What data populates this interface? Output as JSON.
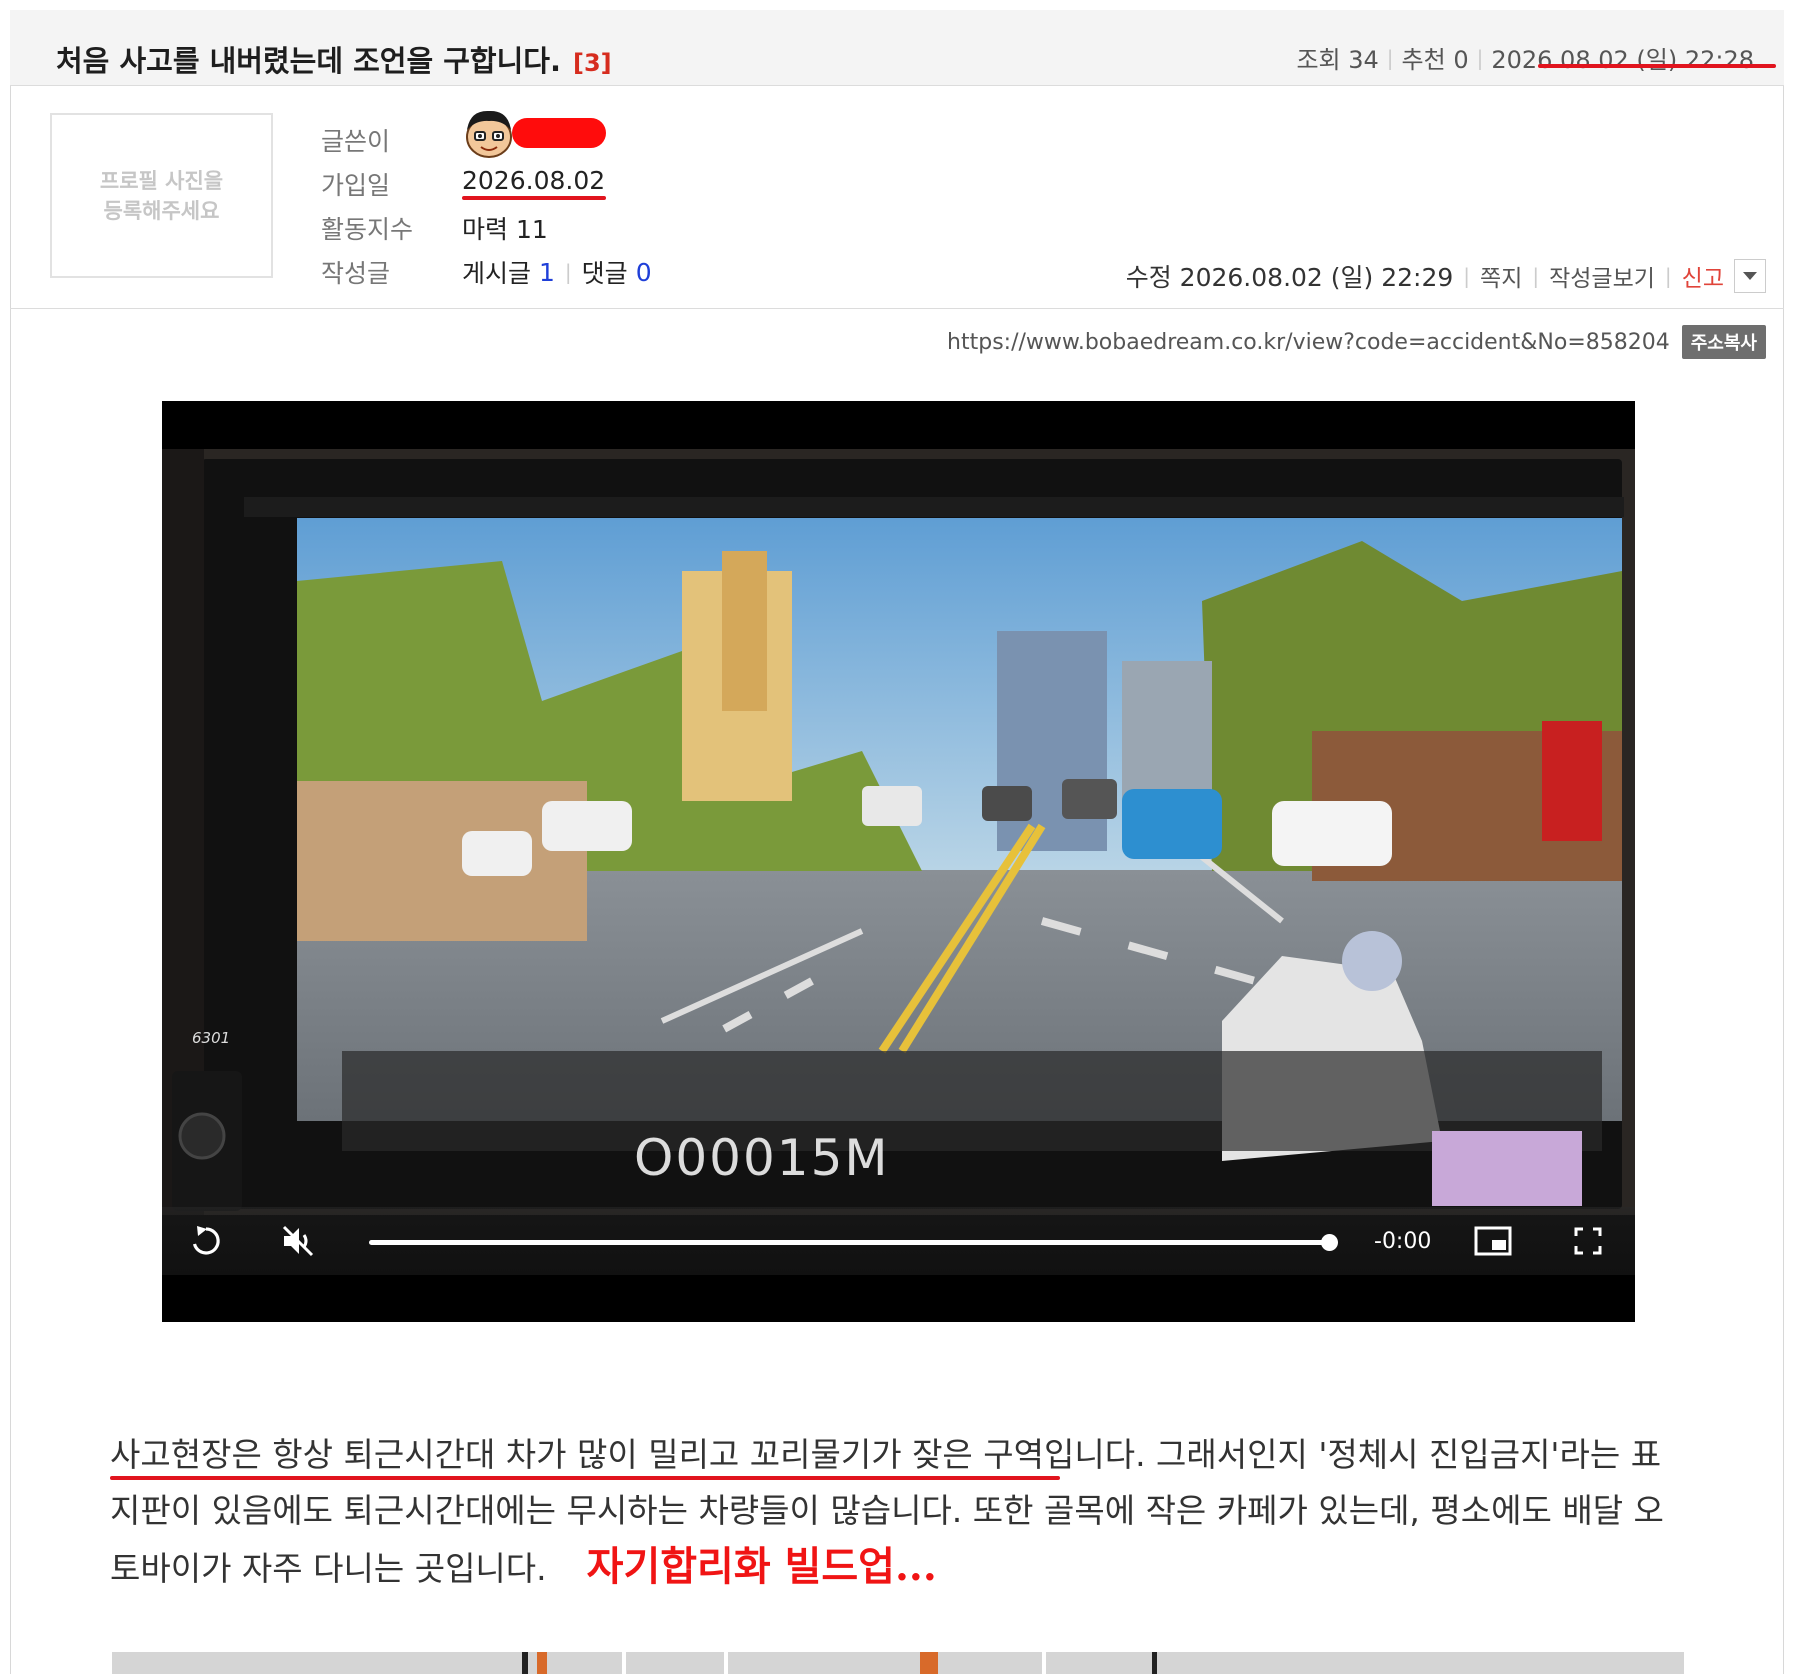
{
  "post": {
    "title": "처음 사고를 내버렸는데 조언을 구합니다.",
    "comment_count": "[3]",
    "views_label": "조회 34",
    "likes_label": "추천 0",
    "date": "2026.08.02 (일) 22:28"
  },
  "profile": {
    "placeholder_line1": "프로필 사진을",
    "placeholder_line2": "등록해주세요",
    "labels": {
      "author": "글쓴이",
      "joined": "가입일",
      "activity": "활동지수",
      "posts": "작성글"
    },
    "joined_date": "2026.08.02",
    "activity_value": "마력 11",
    "posts_label": "게시글",
    "posts_count": "1",
    "comments_label": "댓글",
    "comments_count": "0"
  },
  "meta": {
    "edited": "수정 2026.08.02 (일) 22:29",
    "message": "쪽지",
    "view_posts": "작성글보기",
    "report": "신고"
  },
  "url": {
    "text": "https://www.bobaedream.co.kr/view?code=accident&No=858204",
    "copy_label": "주소복사"
  },
  "video": {
    "remaining_time": "-0:00",
    "progress": 1.0,
    "overlay_text": "O00015M",
    "device_label": "6301"
  },
  "content": {
    "line1": "사고현장은 항상 퇴근시간대 차가 많이 밀리고 꼬리물기가 잦은 구역입니다. 그래서인지 '정체시 진입금지'라는 표",
    "line2": "지판이 있음에도 퇴근시간대에는 무시하는 차량들이 많습니다. 또한 골목에 작은 카페가 있는데, 평소에도 배달 오",
    "line3": "토바이가 자주 다니는 곳입니다.",
    "annotation": "자기합리화 빌드업..."
  },
  "colors": {
    "accent_red": "#e1141e",
    "link_blue": "#1f3fd8",
    "header_bg": "#f4f4f4"
  }
}
